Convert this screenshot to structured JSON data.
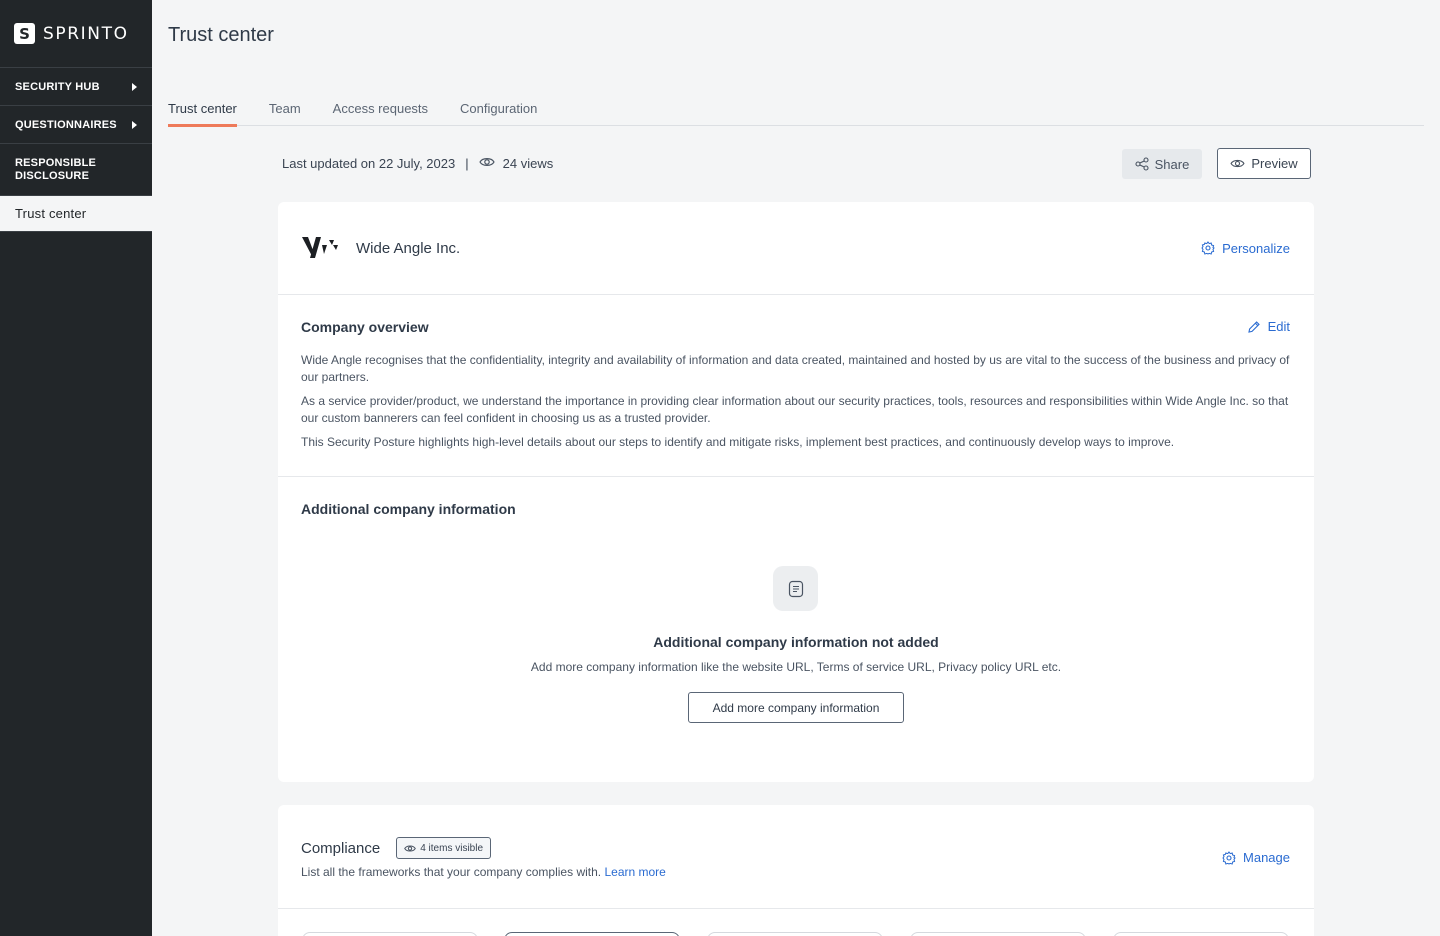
{
  "brand": {
    "mark": "S",
    "name": "SPRINTO"
  },
  "sidebar": {
    "items": [
      {
        "label": "SECURITY HUB"
      },
      {
        "label": "QUESTIONNAIRES"
      },
      {
        "label": "RESPONSIBLE DISCLOSURE"
      },
      {
        "label": "Trust center"
      }
    ]
  },
  "page": {
    "title": "Trust center"
  },
  "tabs": [
    {
      "label": "Trust center"
    },
    {
      "label": "Team"
    },
    {
      "label": "Access requests"
    },
    {
      "label": "Configuration"
    }
  ],
  "meta": {
    "last_updated": "Last updated on 22 July, 2023",
    "divider": "|",
    "views": "24 views"
  },
  "actions": {
    "share": "Share",
    "preview": "Preview"
  },
  "company": {
    "name": "Wide Angle Inc.",
    "personalize": "Personalize"
  },
  "overview": {
    "title": "Company overview",
    "edit": "Edit",
    "paragraphs": [
      "Wide Angle recognises that the confidentiality, integrity and availability of information and data created, maintained and hosted by us are vital to the success of the business and privacy of our partners.",
      "As a service provider/product, we understand the importance in providing clear information about our security practices, tools, resources and responsibilities within Wide Angle Inc. so that our custom bannerers can feel confident in choosing us as a trusted provider.",
      "This Security Posture highlights high-level details about our steps to identify and mitigate risks, implement best practices, and continuously develop ways to improve."
    ]
  },
  "additional": {
    "title": "Additional company information",
    "empty_title": "Additional company information not added",
    "empty_desc": "Add more company information like the website URL, Terms of service URL, Privacy policy URL etc.",
    "add_button": "Add more company information"
  },
  "compliance": {
    "title": "Compliance",
    "badge": "4 items visible",
    "desc": "List all the frameworks that your company complies with.",
    "learn_more": "Learn more",
    "manage": "Manage"
  },
  "colors": {
    "accent_tab": "#ee7a5a",
    "link": "#2a6bd1",
    "sidebar": "#222629"
  }
}
